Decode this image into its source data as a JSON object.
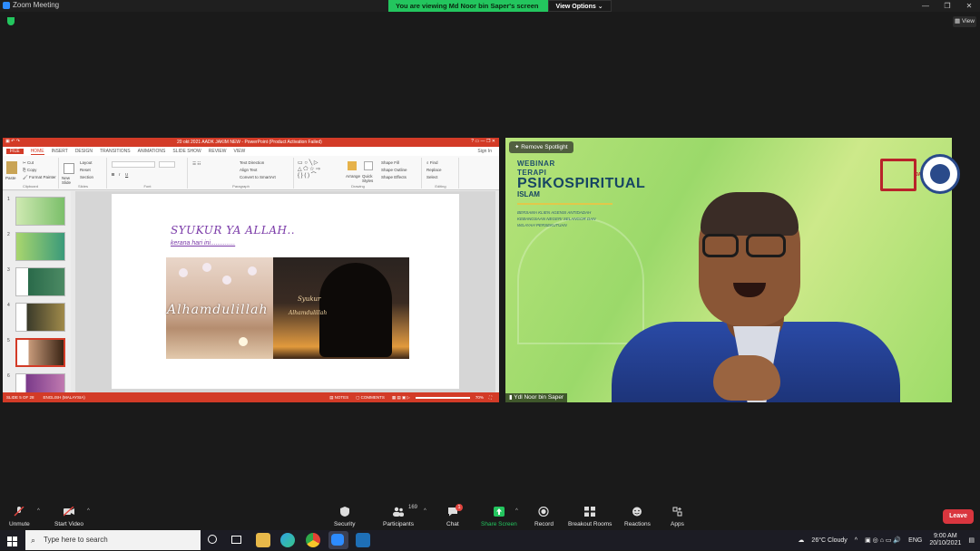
{
  "window": {
    "title": "Zoom Meeting",
    "share_banner": "You are viewing Md Noor bin Saper's screen",
    "view_options": "View Options",
    "view_button": "View",
    "controls": [
      "—",
      "❐",
      "✕"
    ]
  },
  "powerpoint": {
    "title": "20 okt 2021 AADK JAKIM NEW - PowerPoint (Product Activation Failed)",
    "sign_in": "Sign In",
    "tabs": [
      "FILE",
      "HOME",
      "INSERT",
      "DESIGN",
      "TRANSITIONS",
      "ANIMATIONS",
      "SLIDE SHOW",
      "REVIEW",
      "VIEW"
    ],
    "ribbon": {
      "clipboard": {
        "label": "Clipboard",
        "paste": "Paste",
        "cut": "Cut",
        "copy": "Copy",
        "format_painter": "Format Painter"
      },
      "slides": {
        "label": "Slides",
        "new_slide": "New Slide",
        "layout": "Layout",
        "reset": "Reset",
        "section": "Section"
      },
      "font": {
        "label": "Font"
      },
      "paragraph": {
        "label": "Paragraph",
        "text_direction": "Text Direction",
        "align_text": "Align Text",
        "convert": "Convert to SmartArt"
      },
      "drawing": {
        "label": "Drawing",
        "arrange": "Arrange",
        "quick_styles": "Quick Styles",
        "shape_fill": "Shape Fill",
        "shape_outline": "Shape Outline",
        "shape_effects": "Shape Effects"
      },
      "editing": {
        "label": "Editing",
        "find": "Find",
        "replace": "Replace",
        "select": "Select"
      }
    },
    "thumbnail_numbers": [
      "1",
      "2",
      "3",
      "4",
      "5",
      "6"
    ],
    "slide": {
      "title": "SYUKUR YA ALLAH..",
      "subtitle": "kerana hari ini..............",
      "image_text_left": "Alhamdulillah",
      "image_text_right_1": "Syukur",
      "image_text_right_2": "Alhamdulillah"
    },
    "status": {
      "slide_of": "SLIDE 5 OF 28",
      "language": "ENGLISH (MALAYSIA)",
      "notes": "NOTES",
      "comments": "COMMENTS",
      "zoom": "70%"
    }
  },
  "video": {
    "remove_spotlight": "Remove Spotlight",
    "webinar_line1": "WEBINAR",
    "webinar_line2": "TERAPI",
    "webinar_line3": "PSIKOSPIRITUAL",
    "webinar_line4": "ISLAM",
    "desc_line1": "BERSAMA KLIEN AGENSI ANTIDADAH",
    "desc_line2": "KEBANGSAAN NEGERI SELANGOR DAN",
    "desc_line3": "WILAYAH PERSEKUTUAN",
    "logo_text": "JAKIM",
    "participant_name": "Ydl Noor bin Saper"
  },
  "toolbar": {
    "unmute": "Unmute",
    "start_video": "Start Video",
    "security": "Security",
    "participants": "Participants",
    "participants_count": "169",
    "chat": "Chat",
    "chat_badge": "1",
    "share_screen": "Share Screen",
    "record": "Record",
    "breakout_rooms": "Breakout Rooms",
    "reactions": "Reactions",
    "apps": "Apps",
    "leave": "Leave",
    "accent_green": "#23c55e",
    "leave_color": "#d9363e"
  },
  "taskbar": {
    "search_placeholder": "Type here to search",
    "weather": "26°C  Cloudy",
    "language": "ENG",
    "time": "9:00 AM",
    "date": "20/10/2021"
  }
}
